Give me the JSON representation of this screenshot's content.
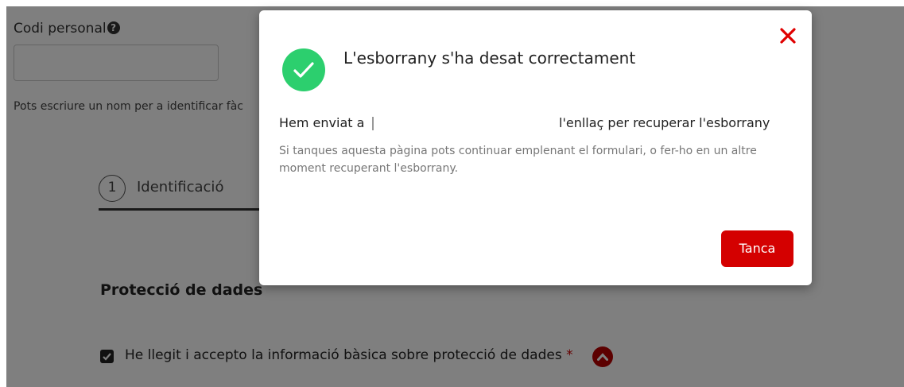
{
  "form": {
    "code_label": "Codi personal",
    "code_value": "",
    "hint": "Pots escriure un nom per a identificar fàc",
    "step_number": "1",
    "step_label": "Identificació",
    "section_title": "Protecció de dades",
    "consent_text": "He llegit i accepto la informació bàsica sobre protecció de dades",
    "required_mark": "*",
    "consent_checked": true
  },
  "modal": {
    "title": "L'esborrany s'ha desat correctament",
    "sent_prefix": "Hem enviat a",
    "sent_suffix": "l'enllaç per recuperar l'esborrany",
    "note": "Si tanques aquesta pàgina pots continuar emplenant el formulari, o fer-ho en un altre moment recuperant l'esborrany.",
    "close_button_label": "Tanca"
  },
  "icons": {
    "help": "help-circle-icon",
    "success": "check-circle-icon",
    "close": "close-icon",
    "checkbox": "checkbox-checked-icon",
    "chevron": "chevron-up-icon"
  },
  "colors": {
    "accent": "#d40000",
    "success": "#2ccf6e",
    "close_x": "#e00000"
  }
}
